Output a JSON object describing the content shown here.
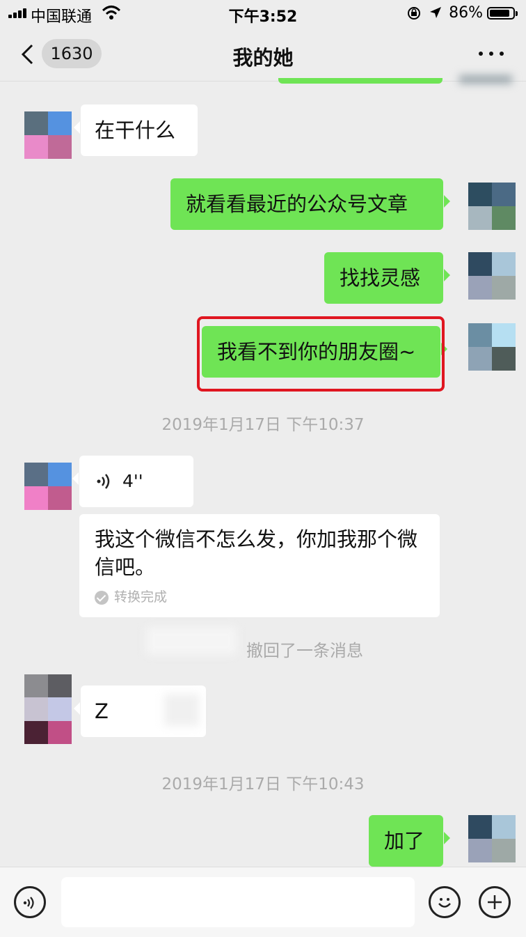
{
  "status": {
    "carrier": "中国联通",
    "time": "下午3:52",
    "battery": "86%"
  },
  "nav": {
    "unread_count": "1630",
    "title": "我的她"
  },
  "messages": {
    "m1": "在干什么",
    "m2": "就看看最近的公众号文章",
    "m3": "找找灵感",
    "m4": "我看不到你的朋友圈~",
    "ts1": "2019年1月17日 下午10:37",
    "voice_duration": "4''",
    "transcript": "我这个微信不怎么发，你加我那个微信吧。",
    "transcript_status": "转换完成",
    "recall": "撤回了一条消息",
    "m5": "Z",
    "ts2": "2019年1月17日 下午10:43",
    "m6": "加了"
  },
  "input": {
    "placeholder": ""
  },
  "colors": {
    "green_bubble": "#6fe455",
    "highlight": "#e01620",
    "background": "#ededed"
  },
  "icons": [
    "signal-icon",
    "wifi-icon",
    "lock-rotation-icon",
    "location-icon",
    "battery-icon",
    "back-chevron-icon",
    "more-icon",
    "voice-icon",
    "emoji-icon",
    "add-icon"
  ]
}
